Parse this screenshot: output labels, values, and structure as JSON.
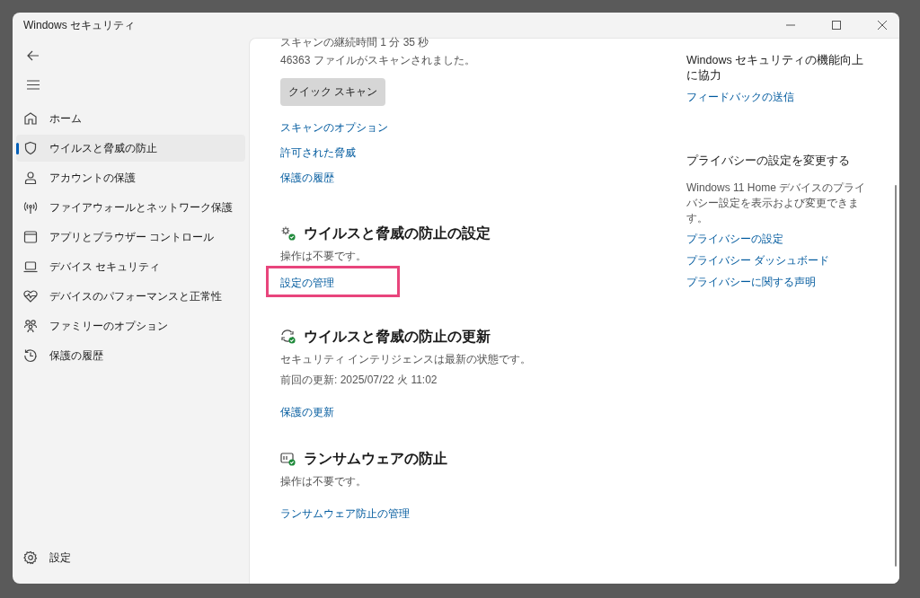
{
  "window": {
    "title": "Windows セキュリティ"
  },
  "nav": {
    "items": [
      {
        "label": "ホーム",
        "selected": false
      },
      {
        "label": "ウイルスと脅威の防止",
        "selected": true
      },
      {
        "label": "アカウントの保護",
        "selected": false
      },
      {
        "label": "ファイアウォールとネットワーク保護",
        "selected": false
      },
      {
        "label": "アプリとブラウザー コントロール",
        "selected": false
      },
      {
        "label": "デバイス セキュリティ",
        "selected": false
      },
      {
        "label": "デバイスのパフォーマンスと正常性",
        "selected": false
      },
      {
        "label": "ファミリーのオプション",
        "selected": false
      },
      {
        "label": "保護の履歴",
        "selected": false
      }
    ],
    "settings": "設定"
  },
  "scan": {
    "lines": [
      "スキャンの継続時間 1 分 35 秒",
      "46363 ファイルがスキャンされました。"
    ],
    "button": "クイック スキャン",
    "links": [
      "スキャンのオプション",
      "許可された脅威",
      "保護の履歴"
    ]
  },
  "sections": [
    {
      "title": "ウイルスと脅威の防止の設定",
      "lines": [
        "操作は不要です。"
      ],
      "links": [
        {
          "label": "設定の管理",
          "highlighted": true
        }
      ]
    },
    {
      "title": "ウイルスと脅威の防止の更新",
      "lines": [
        "セキュリティ インテリジェンスは最新の状態です。",
        "前回の更新: 2025/07/22 火 11:02"
      ],
      "links": [
        {
          "label": "保護の更新",
          "highlighted": false
        }
      ]
    },
    {
      "title": "ランサムウェアの防止",
      "lines": [
        "操作は不要です。"
      ],
      "links": [
        {
          "label": "ランサムウェア防止の管理",
          "highlighted": false
        }
      ]
    }
  ],
  "side_panel": [
    {
      "heading": "Windows セキュリティの機能向上に協力",
      "links": [
        "フィードバックの送信"
      ]
    },
    {
      "heading": "プライバシーの設定を変更する",
      "text": "Windows 11 Home デバイスのプライバシー設定を表示および変更できます。",
      "links": [
        "プライバシーの設定",
        "プライバシー ダッシュボード",
        "プライバシーに関する声明"
      ]
    }
  ]
}
